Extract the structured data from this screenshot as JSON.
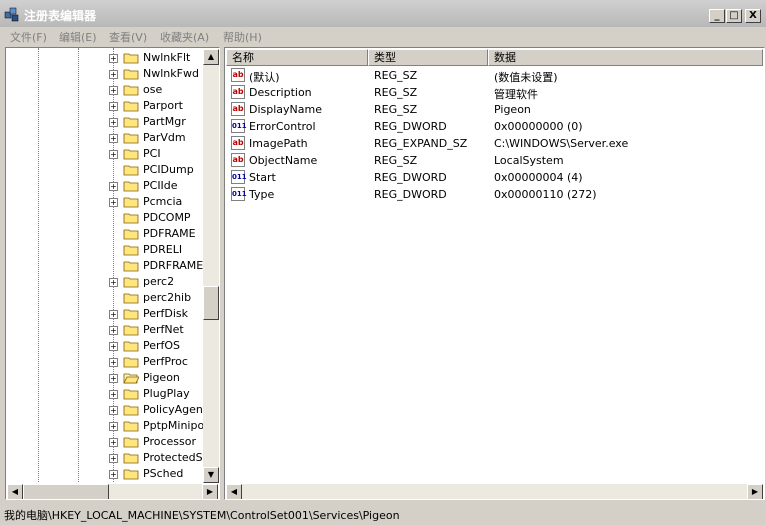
{
  "window": {
    "title": "注册表编辑器"
  },
  "titlebar_buttons": {
    "minimize": "_",
    "maximize": "□",
    "close": "X"
  },
  "menu": [
    "文件(F)",
    "编辑(E)",
    "查看(V)",
    "收藏夹(A)",
    "帮助(H)"
  ],
  "tree": {
    "items": [
      {
        "label": "NwlnkFlt",
        "expandable": true
      },
      {
        "label": "NwlnkFwd",
        "expandable": true
      },
      {
        "label": "ose",
        "expandable": true
      },
      {
        "label": "Parport",
        "expandable": true
      },
      {
        "label": "PartMgr",
        "expandable": true
      },
      {
        "label": "ParVdm",
        "expandable": true
      },
      {
        "label": "PCI",
        "expandable": true
      },
      {
        "label": "PCIDump",
        "expandable": false
      },
      {
        "label": "PCIIde",
        "expandable": true
      },
      {
        "label": "Pcmcia",
        "expandable": true
      },
      {
        "label": "PDCOMP",
        "expandable": false
      },
      {
        "label": "PDFRAME",
        "expandable": false
      },
      {
        "label": "PDRELI",
        "expandable": false
      },
      {
        "label": "PDRFRAME",
        "expandable": false
      },
      {
        "label": "perc2",
        "expandable": true
      },
      {
        "label": "perc2hib",
        "expandable": false
      },
      {
        "label": "PerfDisk",
        "expandable": true
      },
      {
        "label": "PerfNet",
        "expandable": true
      },
      {
        "label": "PerfOS",
        "expandable": true
      },
      {
        "label": "PerfProc",
        "expandable": true
      },
      {
        "label": "Pigeon",
        "expandable": true,
        "open": true
      },
      {
        "label": "PlugPlay",
        "expandable": true
      },
      {
        "label": "PolicyAgent",
        "expandable": true
      },
      {
        "label": "PptpMiniport",
        "expandable": true
      },
      {
        "label": "Processor",
        "expandable": true
      },
      {
        "label": "ProtectedSto",
        "expandable": true
      },
      {
        "label": "PSched",
        "expandable": true
      }
    ]
  },
  "list": {
    "columns": [
      "名称",
      "类型",
      "数据"
    ],
    "rows": [
      {
        "icon": "string-value-icon",
        "name": "(默认)",
        "type": "REG_SZ",
        "data": "(数值未设置)"
      },
      {
        "icon": "string-value-icon",
        "name": "Description",
        "type": "REG_SZ",
        "data": "管理软件"
      },
      {
        "icon": "string-value-icon",
        "name": "DisplayName",
        "type": "REG_SZ",
        "data": "Pigeon"
      },
      {
        "icon": "binary-value-icon",
        "name": "ErrorControl",
        "type": "REG_DWORD",
        "data": "0x00000000 (0)"
      },
      {
        "icon": "string-value-icon",
        "name": "ImagePath",
        "type": "REG_EXPAND_SZ",
        "data": "C:\\WINDOWS\\Server.exe"
      },
      {
        "icon": "string-value-icon",
        "name": "ObjectName",
        "type": "REG_SZ",
        "data": "LocalSystem"
      },
      {
        "icon": "binary-value-icon",
        "name": "Start",
        "type": "REG_DWORD",
        "data": "0x00000004 (4)"
      },
      {
        "icon": "binary-value-icon",
        "name": "Type",
        "type": "REG_DWORD",
        "data": "0x00000110 (272)"
      }
    ]
  },
  "statusbar": {
    "path": "我的电脑\\HKEY_LOCAL_MACHINE\\SYSTEM\\ControlSet001\\Services\\Pigeon"
  },
  "icon_glyphs": {
    "string": "ab",
    "binary": "011"
  },
  "scroll_glyphs": {
    "up": "▲",
    "down": "▼",
    "left": "◀",
    "right": "▶"
  }
}
